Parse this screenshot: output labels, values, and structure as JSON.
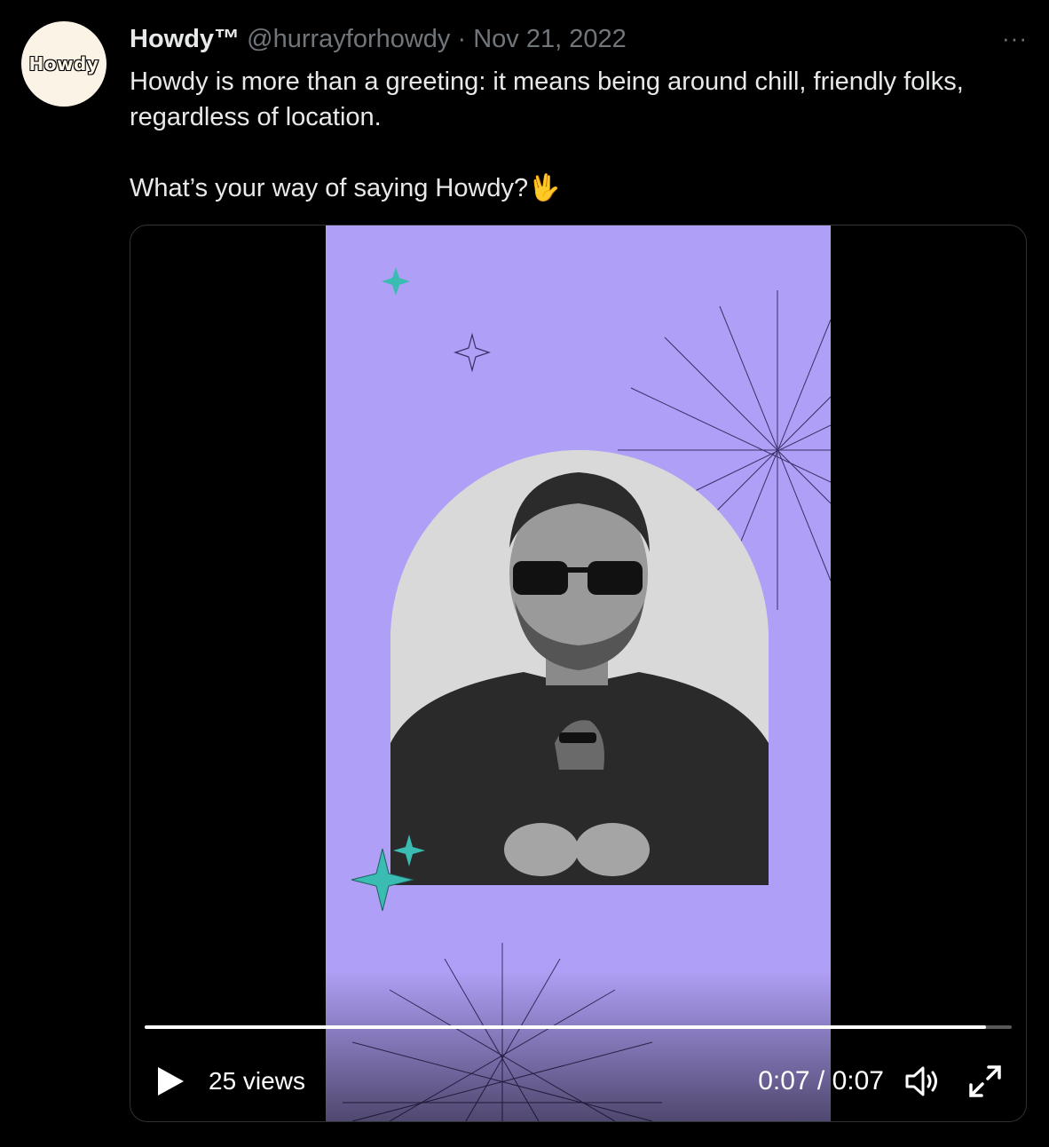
{
  "avatar": {
    "logo_text": "Howdy"
  },
  "author": {
    "display_name": "Howdy™",
    "handle": "@hurrayforhowdy",
    "separator": "·",
    "date": "Nov 21, 2022"
  },
  "more_label": "···",
  "tweet": {
    "line1": "Howdy is more than a greeting: it means being around chill, friendly folks, regardless of location.",
    "line2": "What’s your way of saying Howdy?🖖"
  },
  "video": {
    "views": "25 views",
    "time": "0:07 / 0:07",
    "progress": 0.97
  },
  "colors": {
    "accent_frame": "#b09ff6",
    "sparkle": "#3bbcb3"
  }
}
